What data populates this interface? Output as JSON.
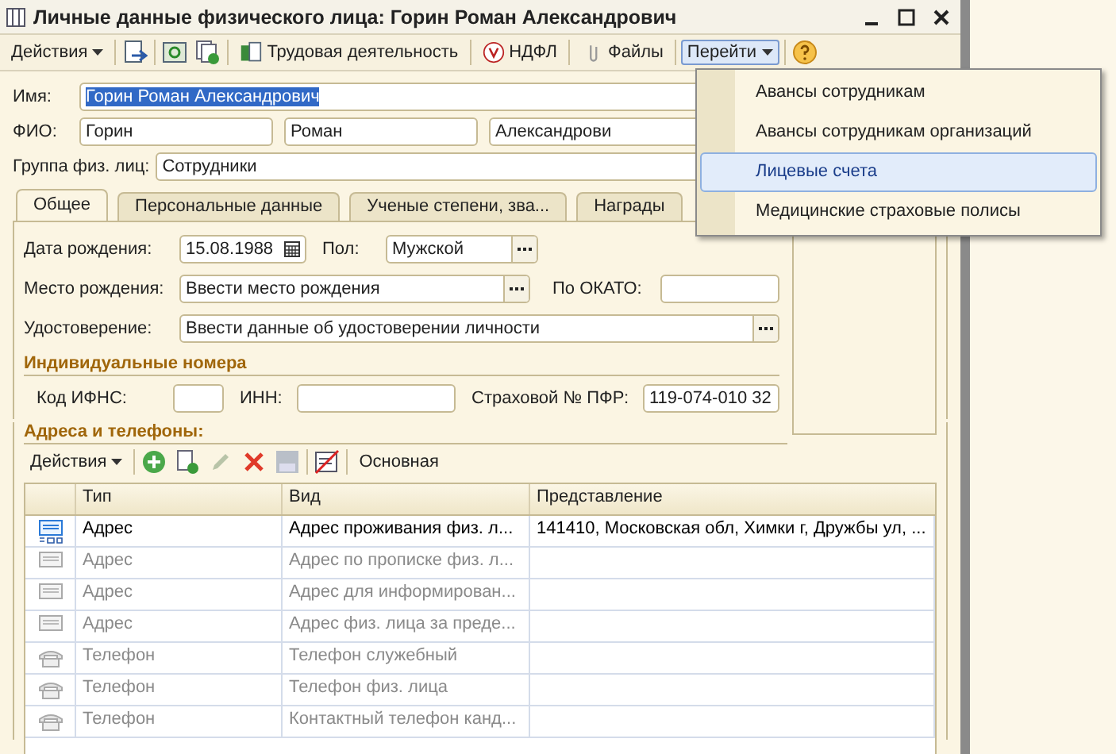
{
  "window": {
    "title": "Личные данные физического лица: Горин Роман Александрович"
  },
  "toolbar": {
    "actions": "Действия",
    "labor": "Трудовая деятельность",
    "ndfl": "НДФЛ",
    "files": "Файлы",
    "goto": "Перейти",
    "goto_open": true
  },
  "goto_menu": [
    {
      "label": "Авансы сотрудникам",
      "selected": false
    },
    {
      "label": "Авансы сотрудникам организаций",
      "selected": false
    },
    {
      "label": "Лицевые счета",
      "selected": true
    },
    {
      "label": "Медицинские страховые полисы",
      "selected": false
    }
  ],
  "name": {
    "label": "Имя:",
    "value": "Горин Роман Александрович"
  },
  "fio": {
    "label": "ФИО:",
    "values": [
      "Горин",
      "Роман",
      "Александрови"
    ]
  },
  "group": {
    "label": "Группа физ. лиц:",
    "value": "Сотрудники"
  },
  "tabs": [
    {
      "label": "Общее",
      "selected": true
    },
    {
      "label": "Персональные данные",
      "selected": false
    },
    {
      "label": "Ученые степени, зва...",
      "selected": false
    },
    {
      "label": "Награды",
      "selected": false
    }
  ],
  "general": {
    "birth_date": {
      "label": "Дата рождения:",
      "value": "15.08.1988"
    },
    "sex": {
      "label": "Пол:",
      "value": "Мужской"
    },
    "birth_place": {
      "label": "Место рождения:",
      "value": "Ввести место рождения"
    },
    "okato": {
      "label": "По ОКАТО:"
    },
    "id_doc": {
      "label": "Удостоверение:",
      "value": "Ввести данные об удостоверении личности"
    }
  },
  "numbers": {
    "title": "Индивидуальные номера",
    "ifns": {
      "label": "Код ИФНС:"
    },
    "inn": {
      "label": "ИНН:"
    },
    "pfr": {
      "label": "Страховой № ПФР:",
      "value": "119-074-010 32"
    }
  },
  "contacts": {
    "title": "Адреса и телефоны:",
    "actions": "Действия",
    "main": "Основная",
    "columns": [
      "Тип",
      "Вид",
      "Представление"
    ],
    "rows": [
      {
        "kind": "address",
        "filled": true,
        "type": "Адрес",
        "view": "Адрес проживания физ. л...",
        "value": "141410, Московская обл, Химки г, Дружбы ул, ..."
      },
      {
        "kind": "address",
        "filled": false,
        "type": "Адрес",
        "view": "Адрес по прописке физ. л..."
      },
      {
        "kind": "address",
        "filled": false,
        "type": "Адрес",
        "view": "Адрес для информирован..."
      },
      {
        "kind": "address",
        "filled": false,
        "type": "Адрес",
        "view": "Адрес физ. лица за преде..."
      },
      {
        "kind": "phone",
        "filled": false,
        "type": "Телефон",
        "view": "Телефон служебный"
      },
      {
        "kind": "phone",
        "filled": false,
        "type": "Телефон",
        "view": "Телефон физ. лица"
      },
      {
        "kind": "phone",
        "filled": false,
        "type": "Телефон",
        "view": "Контактный телефон канд..."
      }
    ]
  }
}
